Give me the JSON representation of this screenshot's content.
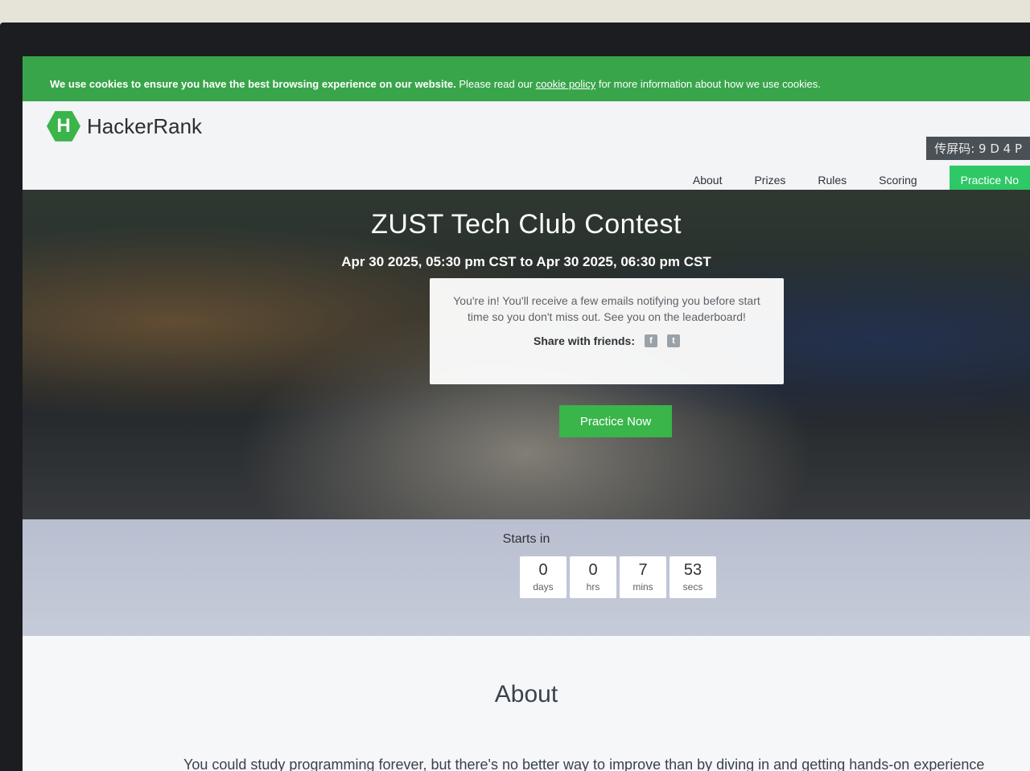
{
  "cookie_banner": {
    "text_bold": "We use cookies to ensure you have the best browsing experience on our website.",
    "text_normal": "Please read our",
    "link": "cookie policy",
    "text_end": "for more information about how we use cookies."
  },
  "screen_code": "传屏码: 9 D 4 P",
  "logo": {
    "mark": "H",
    "name": "HackerRank"
  },
  "nav": {
    "items": [
      "About",
      "Prizes",
      "Rules",
      "Scoring"
    ],
    "cta": "Practice No"
  },
  "hero": {
    "title": "ZUST Tech Club Contest",
    "dates": "Apr 30 2025, 05:30 pm CST to Apr 30 2025, 06:30 pm CST",
    "message": "You're in! You'll receive a few emails notifying you before start time so you don't miss out. See you on the leaderboard!",
    "share_label": "Share with friends:",
    "share_icons": [
      "facebook-icon",
      "twitter-icon"
    ],
    "practice_button": "Practice Now"
  },
  "countdown": {
    "label": "Starts in",
    "units": [
      {
        "value": "0",
        "label": "days"
      },
      {
        "value": "0",
        "label": "hrs"
      },
      {
        "value": "7",
        "label": "mins"
      },
      {
        "value": "53",
        "label": "secs"
      }
    ]
  },
  "about": {
    "title": "About",
    "text": "You could study programming forever, but there's no better way to improve than by diving in and getting hands-on experience"
  },
  "colors": {
    "brand_green": "#39b54a",
    "cookie_green": "#39a54b",
    "text_dark": "#39424e"
  }
}
